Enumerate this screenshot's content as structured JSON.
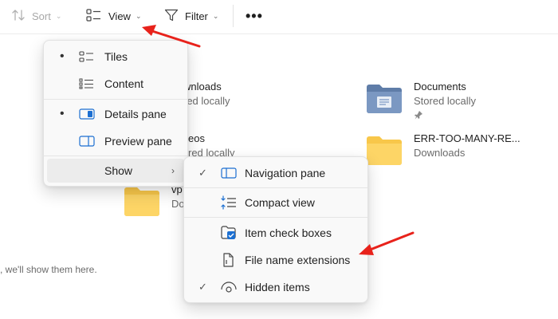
{
  "toolbar": {
    "sort_label": "Sort",
    "view_label": "View",
    "filter_label": "Filter",
    "more_label": "•••"
  },
  "files": [
    {
      "name": "Downloads",
      "sub": "Stored locally"
    },
    {
      "name": "Videos",
      "sub": "Stored locally"
    },
    {
      "name": "vp",
      "sub": "Do"
    },
    {
      "name": "Documents",
      "sub": "Stored locally"
    },
    {
      "name": "ERR-TOO-MANY-RE...",
      "sub": "Downloads"
    }
  ],
  "visible_fragments": {
    "downloads_name": "wnloads",
    "downloads_sub": "red locally",
    "videos_name": "eos",
    "videos_sub": "red locally"
  },
  "empty_hint": ", we'll show them here.",
  "view_menu": {
    "items": [
      {
        "label": "Tiles",
        "selected": true,
        "icon": "tiles-icon"
      },
      {
        "label": "Content",
        "selected": false,
        "icon": "content-icon"
      },
      {
        "label": "Details pane",
        "selected": true,
        "icon": "details-pane-icon"
      },
      {
        "label": "Preview pane",
        "selected": false,
        "icon": "preview-pane-icon"
      },
      {
        "label": "Show",
        "selected": false,
        "icon": "",
        "submenu": true
      }
    ]
  },
  "show_menu": {
    "items": [
      {
        "label": "Navigation pane",
        "checked": true,
        "icon": "navigation-pane-icon"
      },
      {
        "label": "Compact view",
        "checked": false,
        "icon": "compact-view-icon"
      },
      {
        "label": "Item check boxes",
        "checked": false,
        "icon": "item-check-boxes-icon"
      },
      {
        "label": "File name extensions",
        "checked": false,
        "icon": "file-name-extensions-icon"
      },
      {
        "label": "Hidden items",
        "checked": true,
        "icon": "hidden-items-icon"
      }
    ]
  },
  "colors": {
    "folder_yellow": "#f8c74a",
    "documents_folder": "#6e8bb4",
    "annotation_red": "#e8221b",
    "accent_blue": "#1c6fd1"
  }
}
